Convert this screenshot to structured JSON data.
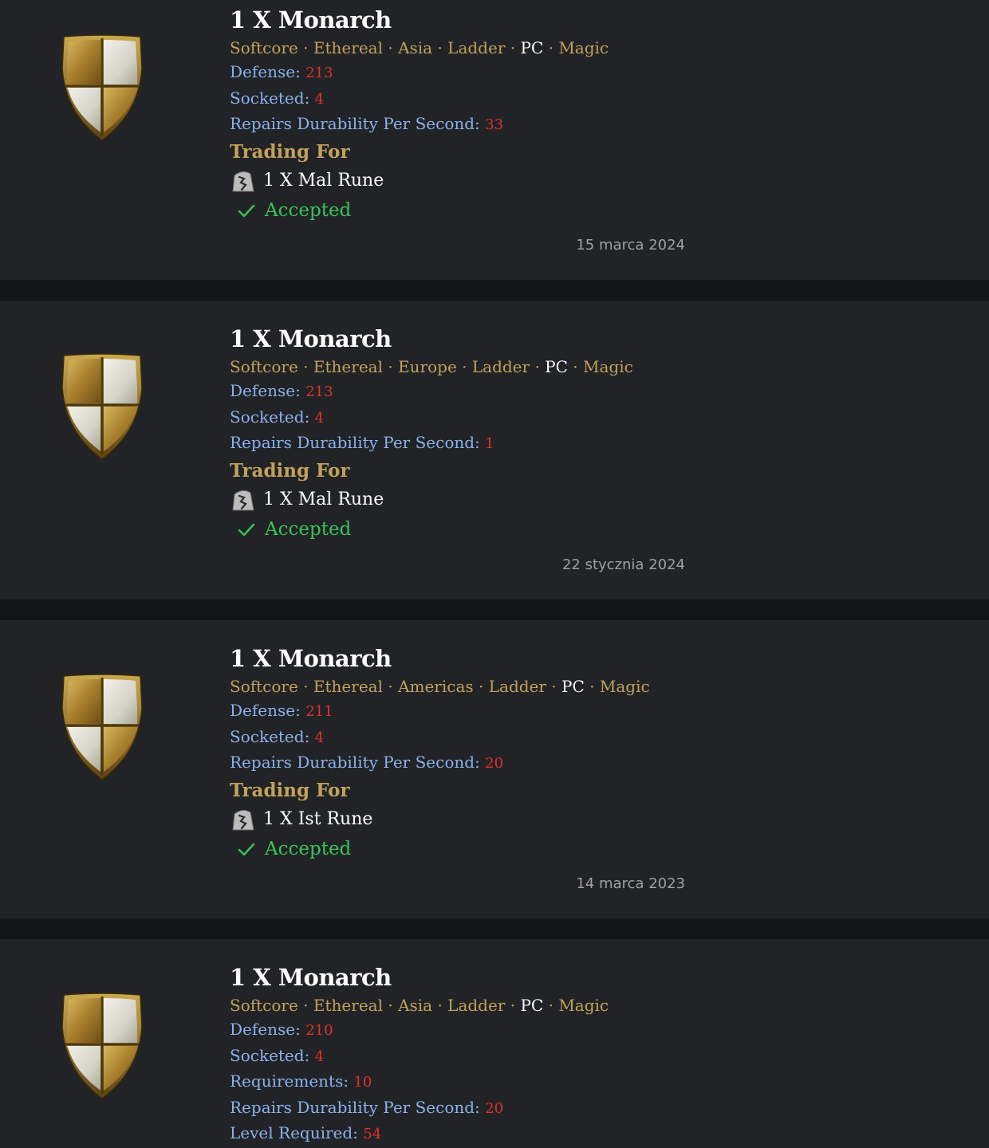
{
  "trades": [
    {
      "title": "1 X Monarch",
      "tags": [
        "Softcore",
        "Ethereal",
        "Asia",
        "Ladder"
      ],
      "platform": "PC",
      "quality": "Magic",
      "stats": [
        {
          "label": "Defense:",
          "value": "213"
        },
        {
          "label": "Socketed:",
          "value": "4"
        },
        {
          "label": "Repairs Durability Per Second:",
          "value": "33"
        }
      ],
      "trading_for_label": "Trading For",
      "offer": "1 X Mal Rune",
      "status": "Accepted",
      "date": "15 marca 2024"
    },
    {
      "title": "1 X Monarch",
      "tags": [
        "Softcore",
        "Ethereal",
        "Europe",
        "Ladder"
      ],
      "platform": "PC",
      "quality": "Magic",
      "stats": [
        {
          "label": "Defense:",
          "value": "213"
        },
        {
          "label": "Socketed:",
          "value": "4"
        },
        {
          "label": "Repairs Durability Per Second:",
          "value": "1"
        }
      ],
      "trading_for_label": "Trading For",
      "offer": "1 X Mal Rune",
      "status": "Accepted",
      "date": "22 stycznia 2024"
    },
    {
      "title": "1 X Monarch",
      "tags": [
        "Softcore",
        "Ethereal",
        "Americas",
        "Ladder"
      ],
      "platform": "PC",
      "quality": "Magic",
      "stats": [
        {
          "label": "Defense:",
          "value": "211"
        },
        {
          "label": "Socketed:",
          "value": "4"
        },
        {
          "label": "Repairs Durability Per Second:",
          "value": "20"
        }
      ],
      "trading_for_label": "Trading For",
      "offer": "1 X Ist Rune",
      "status": "Accepted",
      "date": "14 marca 2023"
    },
    {
      "title": "1 X Monarch",
      "tags": [
        "Softcore",
        "Ethereal",
        "Asia",
        "Ladder"
      ],
      "platform": "PC",
      "quality": "Magic",
      "stats": [
        {
          "label": "Defense:",
          "value": "210"
        },
        {
          "label": "Socketed:",
          "value": "4"
        },
        {
          "label": "Requirements:",
          "value": "10"
        },
        {
          "label": "Repairs Durability Per Second:",
          "value": "20"
        },
        {
          "label": "Level Required:",
          "value": "54"
        }
      ]
    }
  ],
  "colors": {
    "page_bg": "#141517",
    "card_bg": "#222326",
    "tag_gold": "#c2a25a",
    "stat_blue": "#8ab2ee",
    "value_red": "#e2302a",
    "accepted_green": "#38c45b",
    "date_gray": "#9ea0a6"
  },
  "icons": {
    "item": "monarch-shield-icon",
    "rune": "rune-icon",
    "status": "check-icon"
  }
}
